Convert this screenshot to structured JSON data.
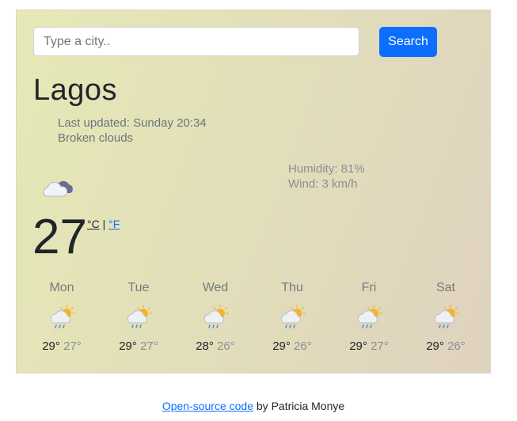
{
  "search": {
    "placeholder": "Type a city..",
    "button_label": "Search"
  },
  "current": {
    "city": "Lagos",
    "last_updated": "Last updated: Sunday 20:34",
    "description": "Broken clouds",
    "humidity": "Humidity: 81%",
    "wind": "Wind: 3 km/h",
    "temperature": "27",
    "unit_c": "°C",
    "unit_separator": "|",
    "unit_f": "°F",
    "icon": "broken-clouds-night-icon"
  },
  "forecast": [
    {
      "day": "Mon",
      "max": "29°",
      "min": "27°",
      "icon": "rain-sun-cloud-icon"
    },
    {
      "day": "Tue",
      "max": "29°",
      "min": "27°",
      "icon": "rain-sun-cloud-icon"
    },
    {
      "day": "Wed",
      "max": "28°",
      "min": "26°",
      "icon": "rain-sun-cloud-icon"
    },
    {
      "day": "Thu",
      "max": "29°",
      "min": "26°",
      "icon": "rain-sun-cloud-icon"
    },
    {
      "day": "Fri",
      "max": "29°",
      "min": "27°",
      "icon": "rain-sun-cloud-icon"
    },
    {
      "day": "Sat",
      "max": "29°",
      "min": "26°",
      "icon": "rain-sun-cloud-icon"
    }
  ],
  "footer": {
    "link_text": "Open-source code",
    "suffix": "by Patricia Monye"
  },
  "colors": {
    "accent": "#0d6efd",
    "card_gradient_start": "#e6e9b6",
    "card_gradient_end": "#dfd2bf"
  }
}
